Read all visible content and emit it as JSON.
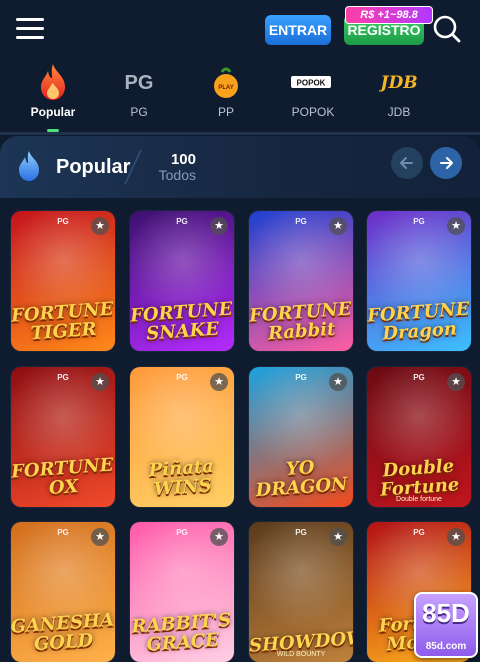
{
  "header": {
    "entrar_label": "ENTRAR",
    "registro_label": "REGISTRO",
    "bonus_badge": "R$ +1~98.8"
  },
  "tabs": [
    {
      "label": "Popular",
      "icon": "flame-icon",
      "active": true
    },
    {
      "label": "PG",
      "icon": "pg-logo-icon"
    },
    {
      "label": "PP",
      "icon": "pp-logo-icon"
    },
    {
      "label": "POPOK",
      "icon": "popok-logo-icon"
    },
    {
      "label": "JDB",
      "icon": "jdb-logo-icon"
    }
  ],
  "tab_logos": {
    "pg": "PG",
    "popok": "POPOK",
    "jdb": "JDB",
    "pp": "PLAY"
  },
  "section": {
    "title": "Popular",
    "count": "100",
    "todos": "Todos"
  },
  "games": [
    {
      "name": "FORTUNE TIGER",
      "sub": "",
      "colors": [
        "#c4121c",
        "#ff8a1a"
      ],
      "provider": "PG"
    },
    {
      "name": "FORTUNE SNAKE",
      "sub": "",
      "colors": [
        "#3b0f6e",
        "#b52cff"
      ],
      "provider": "PG"
    },
    {
      "name": "FORTUNE Rabbit",
      "sub": "",
      "colors": [
        "#1d3fd0",
        "#ff5fa0"
      ],
      "provider": "PG"
    },
    {
      "name": "FORTUNE Dragon",
      "sub": "",
      "colors": [
        "#6d2cc7",
        "#3cc0ff"
      ],
      "provider": "PG"
    },
    {
      "name": "FORTUNE OX",
      "sub": "",
      "colors": [
        "#8e0d12",
        "#f14a2a"
      ],
      "provider": "PG"
    },
    {
      "name": "Piñata WINS",
      "sub": "",
      "colors": [
        "#ff9a3c",
        "#ffd064"
      ],
      "provider": "PG"
    },
    {
      "name": "YO DRAGON",
      "sub": "",
      "colors": [
        "#1aa2e0",
        "#f24a1c"
      ],
      "provider": "PG"
    },
    {
      "name": "Double Fortune",
      "sub": "Double fortune",
      "colors": [
        "#6a0a12",
        "#c2161f"
      ],
      "provider": "PG"
    },
    {
      "name": "GANESHA GOLD",
      "sub": "",
      "colors": [
        "#d26d1c",
        "#ffb14a"
      ],
      "provider": "PG"
    },
    {
      "name": "RABBIT'S GRACE",
      "sub": "",
      "colors": [
        "#ff5aa8",
        "#ffd0e4"
      ],
      "provider": "PG"
    },
    {
      "name": "SHOWDOWN",
      "sub": "WILD BOUNTY",
      "colors": [
        "#5a3a1c",
        "#c0813c"
      ],
      "provider": "PG"
    },
    {
      "name": "Fortune Mouse",
      "sub": "",
      "colors": [
        "#b21016",
        "#ffb21c"
      ],
      "provider": "PG"
    }
  ],
  "floating_logo": {
    "big": "85D",
    "small": "85d.com"
  }
}
